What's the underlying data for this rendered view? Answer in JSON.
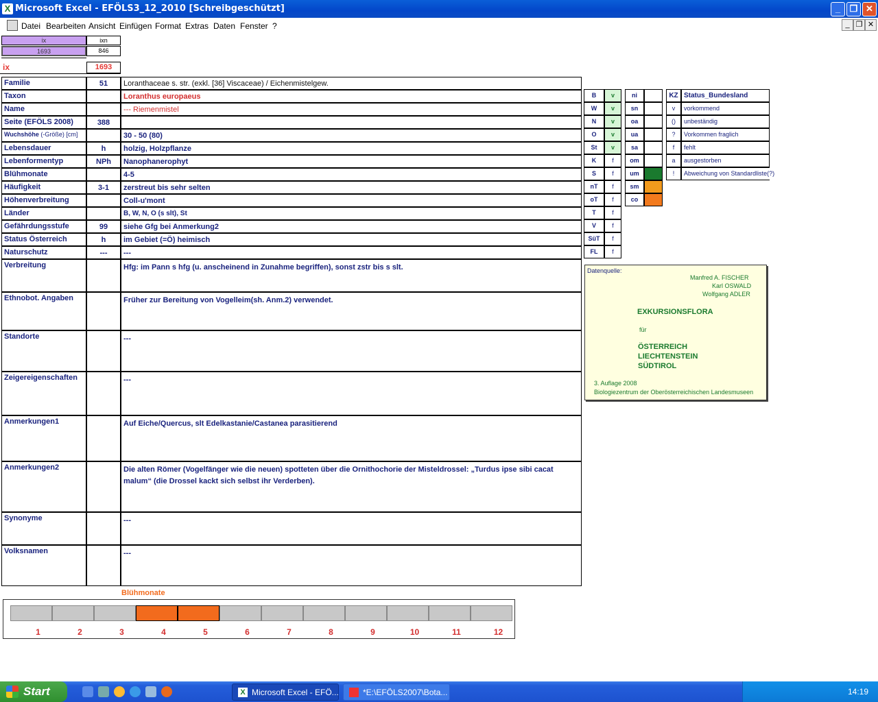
{
  "window": {
    "title": "Microsoft Excel - EFÖLS3_12_2010  [Schreibgeschützt]"
  },
  "menu": [
    "Datei",
    "Bearbeiten",
    "Ansicht",
    "Einfügen",
    "Format",
    "Extras",
    "Daten",
    "Fenster",
    "?"
  ],
  "top": {
    "ix_header": "ix",
    "ixn_header": "ixn",
    "ix_value": "1693",
    "ixn_value": "846",
    "ix_label": "ix",
    "ix_big": "1693"
  },
  "rows": [
    {
      "label": "Familie",
      "num": "51",
      "value": "Loranthaceae s. str. (exkl. [36] Viscaceae)  /  Eichenmistelgew."
    },
    {
      "label": "Taxon",
      "num": "",
      "value": "Loranthus europaeus"
    },
    {
      "label": "Name",
      "num": "",
      "value": "--- Riemenmistel"
    },
    {
      "label": "Seite (EFÖLS 2008)",
      "num": "388",
      "value": ""
    },
    {
      "label": "Wuchshöhe",
      "label_suffix": "(-Größe) [cm]",
      "num": "",
      "value": " 30 - 50 (80)"
    },
    {
      "label": "Lebensdauer",
      "num": "h",
      "value": "holzig, Holzpflanze"
    },
    {
      "label": "Lebenformentyp",
      "num": "NPh",
      "value": "Nanophanerophyt"
    },
    {
      "label": "Blühmonate",
      "num": "",
      "value": " 4-5"
    },
    {
      "label": "Häufigkeit",
      "num": "3-1",
      "value": "zerstreut bis sehr selten"
    },
    {
      "label": "Höhenverbreitung",
      "num": "",
      "value": "Coll-u'mont"
    },
    {
      "label": "Länder",
      "num": "",
      "value": "B, W, N, O (s slt), St"
    },
    {
      "label": "Gefährdungsstufe",
      "num": "99",
      "value": "siehe Gfg bei Anmerkung2"
    },
    {
      "label": "Status Österreich",
      "num": "h",
      "value": "im Gebiet (=Ö) heimisch"
    },
    {
      "label": "Naturschutz",
      "num": "---",
      "value": " ---"
    },
    {
      "label": "Verbreitung",
      "num": "",
      "value": "Hfg: im Pann s hfg (u. anscheinend in Zunahme begriffen), sonst zstr bis s slt."
    },
    {
      "label": "Ethnobot. Angaben",
      "num": "",
      "value": "Früher zur Bereitung von Vogelleim(sh. Anm.2) verwendet."
    },
    {
      "label": "Standorte",
      "num": "",
      "value": "---"
    },
    {
      "label": "Zeigereigenschaften",
      "num": "",
      "value": "---"
    },
    {
      "label": "Anmerkungen1",
      "num": "",
      "value": "Auf Eiche/Quercus, slt Edelkastanie/Castanea parasitierend"
    },
    {
      "label": "Anmerkungen2",
      "num": "",
      "value": "Die alten Römer (Vogelfänger wie die neuen) spotteten über die Ornithochorie der Misteldrossel: „Turdus ipse sibi cacat malum“ (die Drossel kackt sich selbst ihr Verderben)."
    },
    {
      "label": "Synonyme",
      "num": "",
      "value": "---"
    },
    {
      "label": "Volksnamen",
      "num": "",
      "value": "---"
    }
  ],
  "laender": [
    {
      "code": "B",
      "val": "v"
    },
    {
      "code": "W",
      "val": "v"
    },
    {
      "code": "N",
      "val": "v"
    },
    {
      "code": "O",
      "val": "v"
    },
    {
      "code": "St",
      "val": "v"
    },
    {
      "code": "K",
      "val": "f"
    },
    {
      "code": "S",
      "val": "f"
    },
    {
      "code": "nT",
      "val": "f"
    },
    {
      "code": "oT",
      "val": "f"
    },
    {
      "code": "T",
      "val": "f"
    },
    {
      "code": "V",
      "val": "f"
    },
    {
      "code": "SüT",
      "val": "f"
    },
    {
      "code": "FL",
      "val": "f"
    }
  ],
  "hoehen": [
    {
      "code": "ni",
      "color": ""
    },
    {
      "code": "sn",
      "color": ""
    },
    {
      "code": "oa",
      "color": ""
    },
    {
      "code": "ua",
      "color": ""
    },
    {
      "code": "sa",
      "color": ""
    },
    {
      "code": "om",
      "color": ""
    },
    {
      "code": "um",
      "color": "#1a7a2e"
    },
    {
      "code": "sm",
      "color": "#f29a1d"
    },
    {
      "code": "co",
      "color": "#f27a1d"
    }
  ],
  "status": {
    "header": {
      "kz": "KZ",
      "text": "Status_Bundesland"
    },
    "items": [
      {
        "kz": "v",
        "text": "vorkommend"
      },
      {
        "kz": "()",
        "text": "unbeständig"
      },
      {
        "kz": "?",
        "text": "Vorkommen fraglich"
      },
      {
        "kz": "f",
        "text": "fehlt"
      },
      {
        "kz": "a",
        "text": "ausgestorben"
      },
      {
        "kz": "!",
        "text": "Abweichung von Standardliste(?)"
      }
    ]
  },
  "quelle": {
    "label": "Datenquelle:",
    "authors": [
      "Manfred A. FISCHER",
      "Karl OSWALD",
      "Wolfgang ADLER"
    ],
    "title": "EXKURSIONSFLORA",
    "fuer": "für",
    "countries": [
      "ÖSTERREICH",
      "LIECHTENSTEIN",
      "SÜDTIROL"
    ],
    "edition": "3. Auflage 2008",
    "publisher": "Biologiezentrum der Oberösterreichischen Landesmuseen"
  },
  "bluehmonate": {
    "title": "Blühmonate",
    "months": [
      "1",
      "2",
      "3",
      "4",
      "5",
      "6",
      "7",
      "8",
      "9",
      "10",
      "11",
      "12"
    ],
    "active": [
      4,
      5
    ],
    "active_color": "#f26b1d",
    "inactive_color": "#c8c8c8"
  },
  "taskbar": {
    "start": "Start",
    "tasks": [
      "Microsoft Excel - EFÖ...",
      "*E:\\EFÖLS2007\\Bota..."
    ],
    "clock": "14:19"
  }
}
